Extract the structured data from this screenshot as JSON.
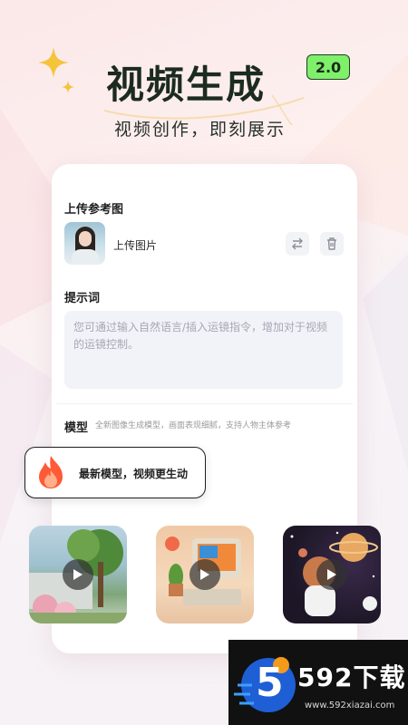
{
  "header": {
    "title": "视频生成",
    "version_badge": "2.0",
    "subtitle": "视频创作，即刻展示"
  },
  "upload": {
    "section_title": "上传参考图",
    "label": "上传图片",
    "icons": [
      "swap-icon",
      "trash-icon"
    ]
  },
  "prompt": {
    "section_title": "提示词",
    "placeholder": "您可通过输入自然语言/插入运镜指令，增加对于视频的运镜控制。"
  },
  "model": {
    "section_title": "模型",
    "description": "全新图像生成模型，画面表现细腻，支持人物主体参考"
  },
  "tip": {
    "text": "最新模型，视频更生动",
    "icon": "fire-icon"
  },
  "videos": [
    {
      "name": "garden-wall-scene",
      "icon": "play-icon"
    },
    {
      "name": "retro-computer-scene",
      "icon": "play-icon"
    },
    {
      "name": "astronaut-cat-scene",
      "icon": "play-icon"
    }
  ],
  "watermark": {
    "logo_digit": "5",
    "brand": "592下载",
    "url": "www.592xiazai.com"
  },
  "colors": {
    "badge_green": "#7ef06a",
    "title_dark": "#1b2b1f",
    "fire_orange": "#ff6a3d"
  }
}
